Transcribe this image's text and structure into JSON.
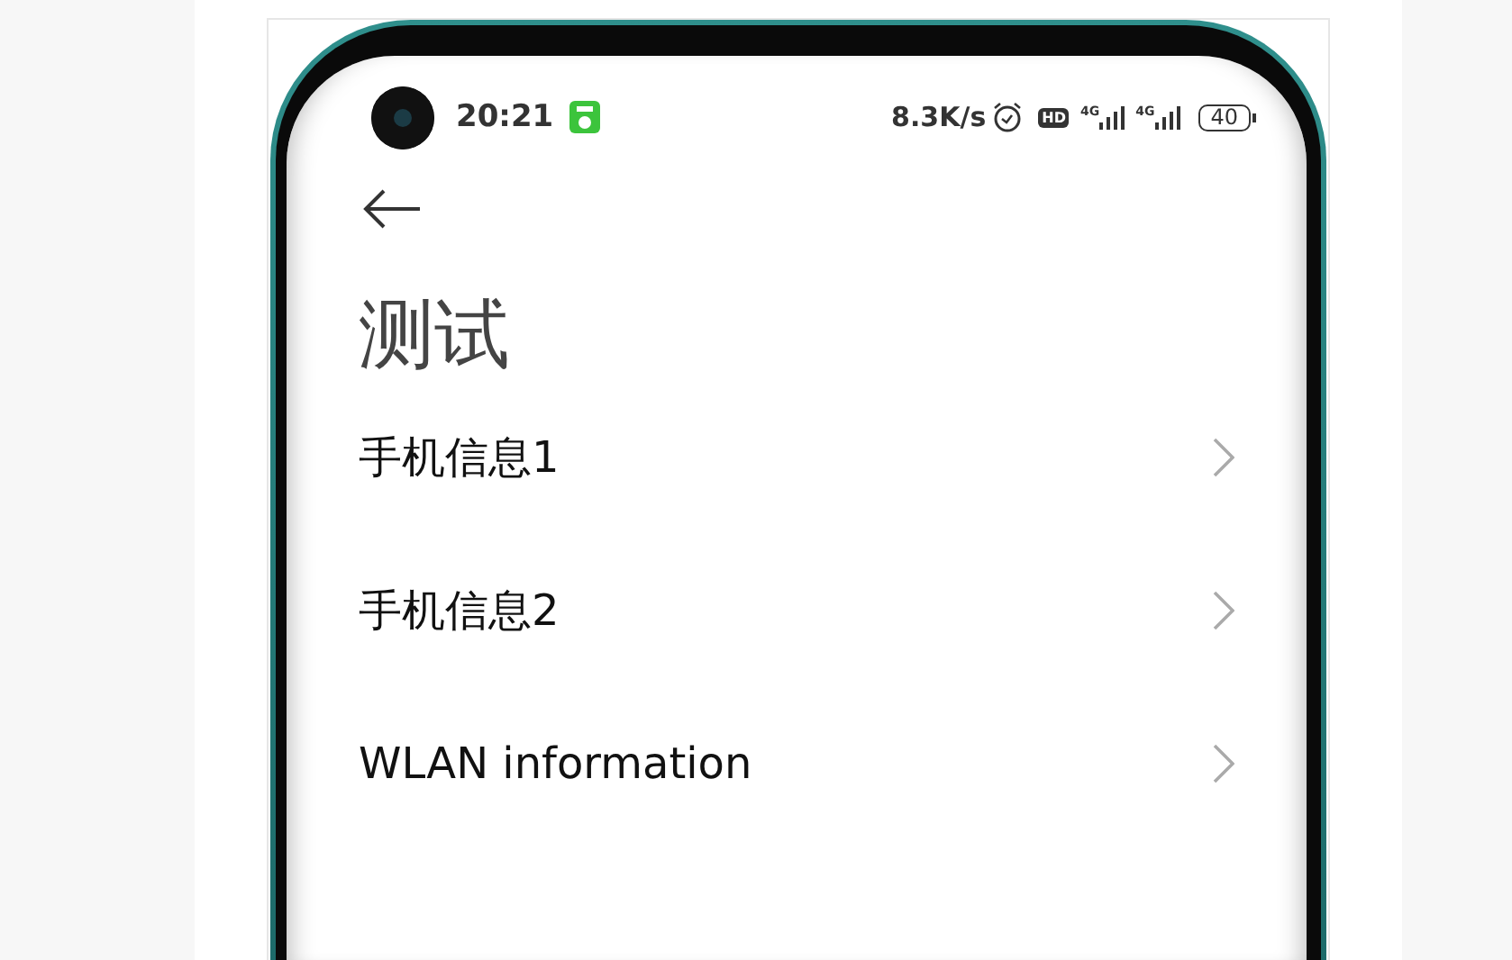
{
  "status_bar": {
    "time": "20:21",
    "speed": "8.3K/s",
    "hd": "HD",
    "sim_1": "4G",
    "sim_2": "4G",
    "battery": "40"
  },
  "page": {
    "title": "测试"
  },
  "items": [
    {
      "label": "手机信息1"
    },
    {
      "label": "手机信息2"
    },
    {
      "label": "WLAN information"
    }
  ]
}
